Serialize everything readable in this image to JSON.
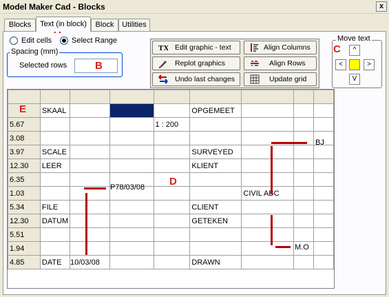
{
  "window": {
    "title": "Model Maker Cad - Blocks",
    "close_label": "x"
  },
  "tabs": [
    "Blocks",
    "Text (in block)",
    "Block",
    "Utilities"
  ],
  "mode": {
    "edit_cells": "Edit cells",
    "select_range": "Select Range",
    "selected": "select_range"
  },
  "spacing": {
    "group_label": "Spacing (mm)",
    "selected_rows_label": "Selected rows",
    "selected_rows_value": ""
  },
  "buttons": {
    "edit_graphic": "Edit graphic - text",
    "replot": "Replot graphics",
    "undo": "Undo last changes",
    "align_columns": "Align Columns",
    "align_rows": "Align Rows",
    "update_grid": "Update grid"
  },
  "move_text": {
    "label": "Move text",
    "up": "^",
    "down": "V",
    "left": "<",
    "right": ">",
    "center_color": "#ffff00"
  },
  "grid": {
    "rows": [
      {
        "header": "",
        "cells": [
          "SKAAL",
          "",
          "",
          "",
          "OPGEMEET",
          "",
          "",
          ""
        ]
      },
      {
        "header": "5.67",
        "cells": [
          "",
          "",
          "",
          "1 : 200",
          "",
          "",
          "",
          ""
        ]
      },
      {
        "header": "3.08",
        "cells": [
          "",
          "",
          "",
          "",
          "",
          "",
          "",
          ""
        ]
      },
      {
        "header": "3.97",
        "cells": [
          "SCALE",
          "",
          "",
          "",
          "SURVEYED",
          "",
          "",
          ""
        ]
      },
      {
        "header": "12.30",
        "cells": [
          "LEER",
          "",
          "",
          "",
          "KLIENT",
          "",
          "",
          ""
        ]
      },
      {
        "header": "6.35",
        "cells": [
          "",
          "",
          "",
          "",
          "",
          "",
          "",
          ""
        ]
      },
      {
        "header": "1.03",
        "cells": [
          "",
          "",
          "",
          "",
          "",
          "CIVIL ABC",
          "",
          ""
        ]
      },
      {
        "header": "5.34",
        "cells": [
          "FILE",
          "",
          "",
          "",
          "CLIENT",
          "",
          "",
          ""
        ]
      },
      {
        "header": "12.30",
        "cells": [
          "DATUM",
          "",
          "",
          "",
          "GETEKEN",
          "",
          "",
          ""
        ]
      },
      {
        "header": "5.51",
        "cells": [
          "",
          "",
          "",
          "",
          "",
          "",
          "",
          ""
        ]
      },
      {
        "header": "1.94",
        "cells": [
          "",
          "",
          "",
          "",
          "",
          "",
          "",
          ""
        ]
      },
      {
        "header": "4.85",
        "cells": [
          "DATE",
          "",
          "",
          "",
          "DRAWN",
          "",
          "",
          ""
        ]
      }
    ],
    "floating": {
      "bj": "BJ",
      "p78": "P78/03/08",
      "mo": "M.O",
      "date": "10/03/08"
    },
    "selection_color": "#0a246a"
  },
  "annotations": {
    "a": "A",
    "b": "B",
    "c": "C",
    "d": "D",
    "e": "E",
    "color": "#d42020"
  }
}
